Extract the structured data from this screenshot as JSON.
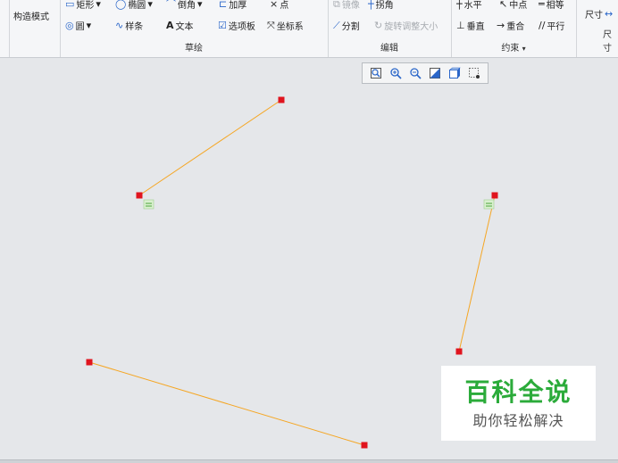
{
  "ribbon": {
    "left_group": {
      "construct_mode": "构造模式"
    },
    "sketch_group": {
      "label": "草绘",
      "rect": "矩形",
      "ellipse": "椭圆",
      "fillet": "倒角",
      "thicken": "加厚",
      "point": "点",
      "circle": "圆",
      "spline": "样条",
      "text": "文本",
      "palette": "选项板",
      "coord": "坐标系"
    },
    "edit_group": {
      "label": "编辑",
      "mirror": "镜像",
      "trim": "拐角",
      "divide": "分割",
      "rotate_resize": "旋转调整大小"
    },
    "constraint_group": {
      "label": "约束",
      "horizontal": "水平",
      "midpoint": "中点",
      "equal": "相等",
      "vertical": "垂直",
      "coincident": "重合",
      "parallel": "平行"
    },
    "dimension_group": {
      "label": "尺寸",
      "dimension": "尺寸"
    }
  },
  "colors": {
    "line": "#f5a623",
    "endpoint": "#e0141e",
    "constraint": "#4aa33a"
  },
  "watermark": {
    "title": "百科全说",
    "subtitle": "助你轻松解决"
  }
}
